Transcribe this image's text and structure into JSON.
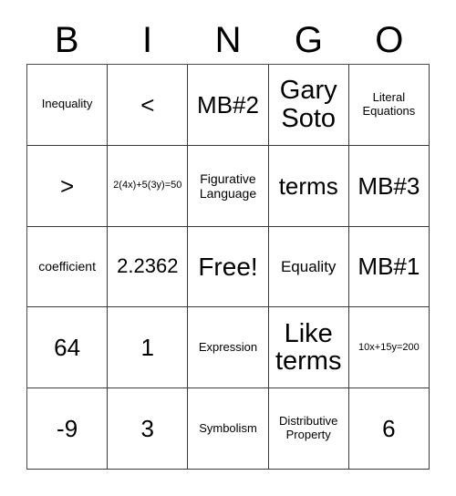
{
  "card": {
    "type": "bingo-card",
    "columns": 5,
    "rows": 5,
    "header": {
      "letters": [
        "B",
        "I",
        "N",
        "G",
        "O"
      ]
    },
    "colors": {
      "background": "#ffffff",
      "text": "#000000",
      "grid_line": "#3a3a3a"
    },
    "cells": [
      [
        {
          "text": "Inequality",
          "size": "sm"
        },
        {
          "text": "<",
          "size": "xl"
        },
        {
          "text": "MB#2",
          "size": "xl"
        },
        {
          "text": "Gary Soto",
          "size": "xxl"
        },
        {
          "text": "Literal Equations",
          "size": "sm"
        }
      ],
      [
        {
          "text": ">",
          "size": "xl"
        },
        {
          "text": "2(4x)+5(3y)=50",
          "size": "xs"
        },
        {
          "text": "Figurative Language",
          "size": "smm"
        },
        {
          "text": "terms",
          "size": "xl"
        },
        {
          "text": "MB#3",
          "size": "xl"
        }
      ],
      [
        {
          "text": "coefficient",
          "size": "smm"
        },
        {
          "text": "2.2362",
          "size": "lg"
        },
        {
          "text": "Free!",
          "size": "free"
        },
        {
          "text": "Equality",
          "size": "md"
        },
        {
          "text": "MB#1",
          "size": "xl"
        }
      ],
      [
        {
          "text": "64",
          "size": "xl"
        },
        {
          "text": "1",
          "size": "xl"
        },
        {
          "text": "Expression",
          "size": "sm"
        },
        {
          "text": "Like terms",
          "size": "xxl"
        },
        {
          "text": "10x+15y=200",
          "size": "xs"
        }
      ],
      [
        {
          "text": "-9",
          "size": "xl"
        },
        {
          "text": "3",
          "size": "xl"
        },
        {
          "text": "Symbolism",
          "size": "sm"
        },
        {
          "text": "Distributive Property",
          "size": "sm"
        },
        {
          "text": "6",
          "size": "xl"
        }
      ]
    ]
  }
}
